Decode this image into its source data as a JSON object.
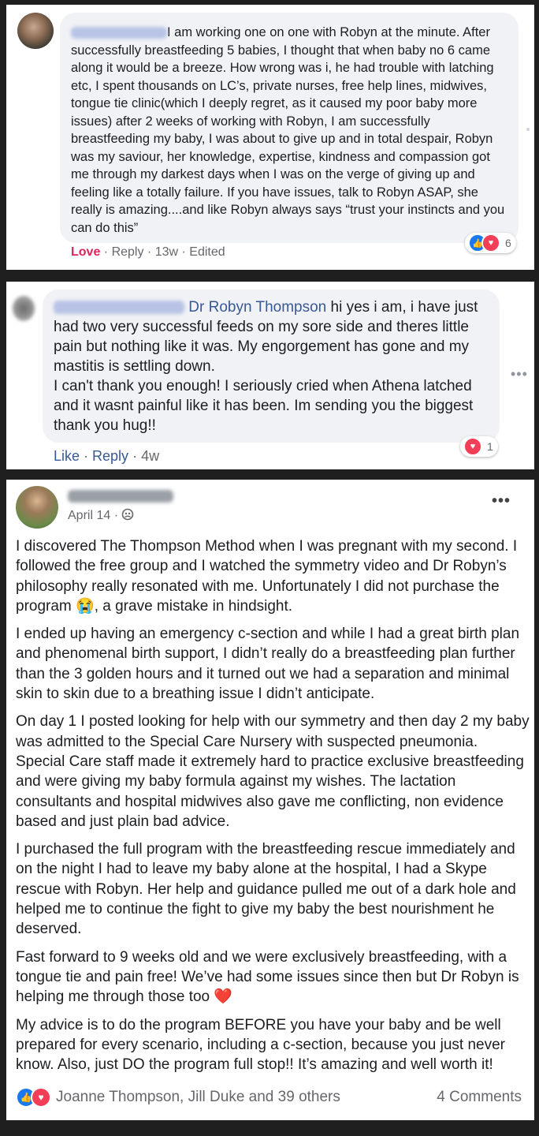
{
  "comment1": {
    "name_blurred": "Kelly Papilmouni",
    "text": "I am working one on one with Robyn at the minute. After successfully breastfeeding 5 babies, I thought that when baby no 6 came along it would be a breeze. How wrong was i, he had trouble with latching etc, I spent thousands on LC’s, private nurses, free help lines, midwives, tongue tie clinic(which I deeply regret, as it caused my poor baby more issues) after 2 weeks of working with Robyn, I am successfully breastfeeding my baby, I was about to give up and in total despair, Robyn was my saviour, her knowledge, expertise, kindness and compassion got me through my darkest days when I was on the verge of giving up and feeling like a totally failure. If you have issues, talk to Robyn ASAP, she really is amazing....and like Robyn always says “trust your instincts and you can do this”",
    "actions": {
      "love": "Love",
      "sep1": " · ",
      "reply": "Reply",
      "sep2": " · ",
      "time": "13w",
      "sep3": " · ",
      "edited": "Edited"
    },
    "reaction_count": "6"
  },
  "comment2": {
    "name_blurred": "Melisa Haverfield",
    "mention": "Dr Robyn Thompson",
    "text": " hi yes i am, i have just had two very successful feeds on my sore side and theres little pain but nothing like it was. My engorgement has gone and my mastitis is settling down.",
    "text2": "I can't thank you enough! I seriously cried when Athena latched and it wasnt painful like it has been. Im sending you the biggest thank you hug!!",
    "actions": {
      "like": "Like",
      "sep1": " · ",
      "reply": "Reply",
      "sep2": " · ",
      "time": "4w"
    },
    "reaction_count": "1",
    "more": "•••"
  },
  "post": {
    "author_blurred": "Marion George",
    "date": "April 14 · ",
    "privacy_icon": "friends-icon",
    "more": "•••",
    "paragraphs": [
      {
        "text": "I discovered The Thompson Method when I was pregnant with my second. I followed the free group and I watched the symmetry video and Dr Robyn’s philosophy really resonated with me. Unfortunately I did not purchase the program ",
        "emoji": "😭",
        "after": ", a grave mistake in hindsight."
      },
      {
        "text": "I ended up having an emergency c-section and while I had a great birth plan and phenomenal birth support, I didn’t really do a breastfeeding plan further than the 3 golden hours and it turned out we had a separation and minimal skin to skin due to a breathing issue I didn’t anticipate.",
        "emoji": "",
        "after": ""
      },
      {
        "text": "On day 1 I posted looking for help with our symmetry and then day 2 my baby was admitted to the Special Care Nursery with suspected pneumonia. Special Care staff made it extremely hard to practice exclusive breastfeeding and were giving my baby formula against my wishes. The lactation consultants and hospital midwives also gave me conflicting, non evidence based and just plain bad advice.",
        "emoji": "",
        "after": ""
      },
      {
        "text": "I purchased the full program with the breastfeeding rescue immediately and on the night I had to leave my baby alone at the hospital, I had a Skype rescue with Robyn. Her help and guidance pulled me out of a dark hole and helped me to continue the fight to give my baby the best nourishment he deserved.",
        "emoji": "",
        "after": ""
      },
      {
        "text": "Fast forward to 9 weeks old and we were exclusively breastfeeding, with a tongue tie and pain free! We’ve had some issues since then but Dr Robyn is helping me through those too ",
        "emoji": "❤️",
        "after": ""
      },
      {
        "text": "My advice is to do the program BEFORE you have your baby and be well prepared for every scenario, including a c-section, because you just never know. Also, just DO the program full stop!! It’s amazing and well worth it!",
        "emoji": "",
        "after": ""
      }
    ],
    "reactions_text": "Joanne Thompson, Jill Duke and 39 others",
    "comments_text": "4 Comments"
  },
  "icons": {
    "like": "👍",
    "heart": "♥"
  }
}
